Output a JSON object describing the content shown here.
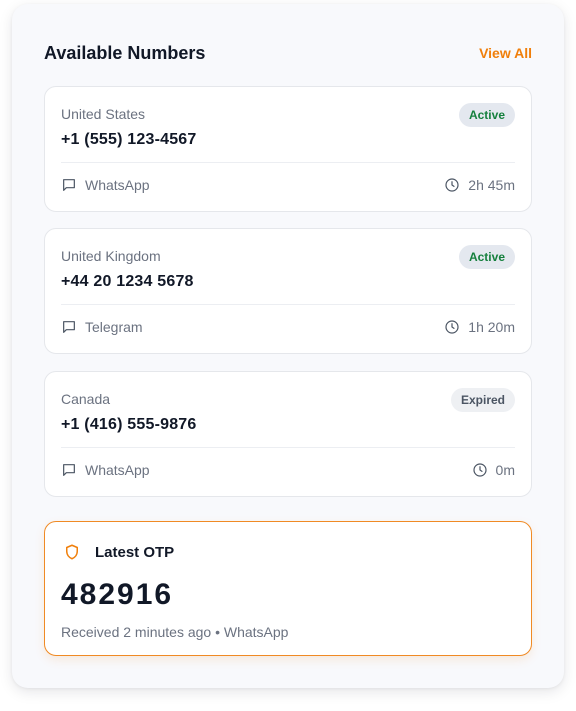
{
  "header": {
    "title": "Available Numbers",
    "view_all_label": "View All"
  },
  "numbers": [
    {
      "country": "United States",
      "phone": "+1 (555) 123-4567",
      "status": "Active",
      "app": "WhatsApp",
      "time_left": "2h 45m"
    },
    {
      "country": "United Kingdom",
      "phone": "+44 20 1234 5678",
      "status": "Active",
      "app": "Telegram",
      "time_left": "1h 20m"
    },
    {
      "country": "Canada",
      "phone": "+1 (416) 555-9876",
      "status": "Expired",
      "app": "WhatsApp",
      "time_left": "0m"
    }
  ],
  "otp": {
    "title": "Latest OTP",
    "code": "482916",
    "received_text": "Received 2 minutes ago • WhatsApp"
  },
  "icons": {
    "message": "message-square-icon",
    "clock": "clock-icon",
    "shield": "shield-icon"
  },
  "colors": {
    "accent": "#f07f0b",
    "active_text": "#15803d",
    "expired_text": "#4b5563"
  }
}
